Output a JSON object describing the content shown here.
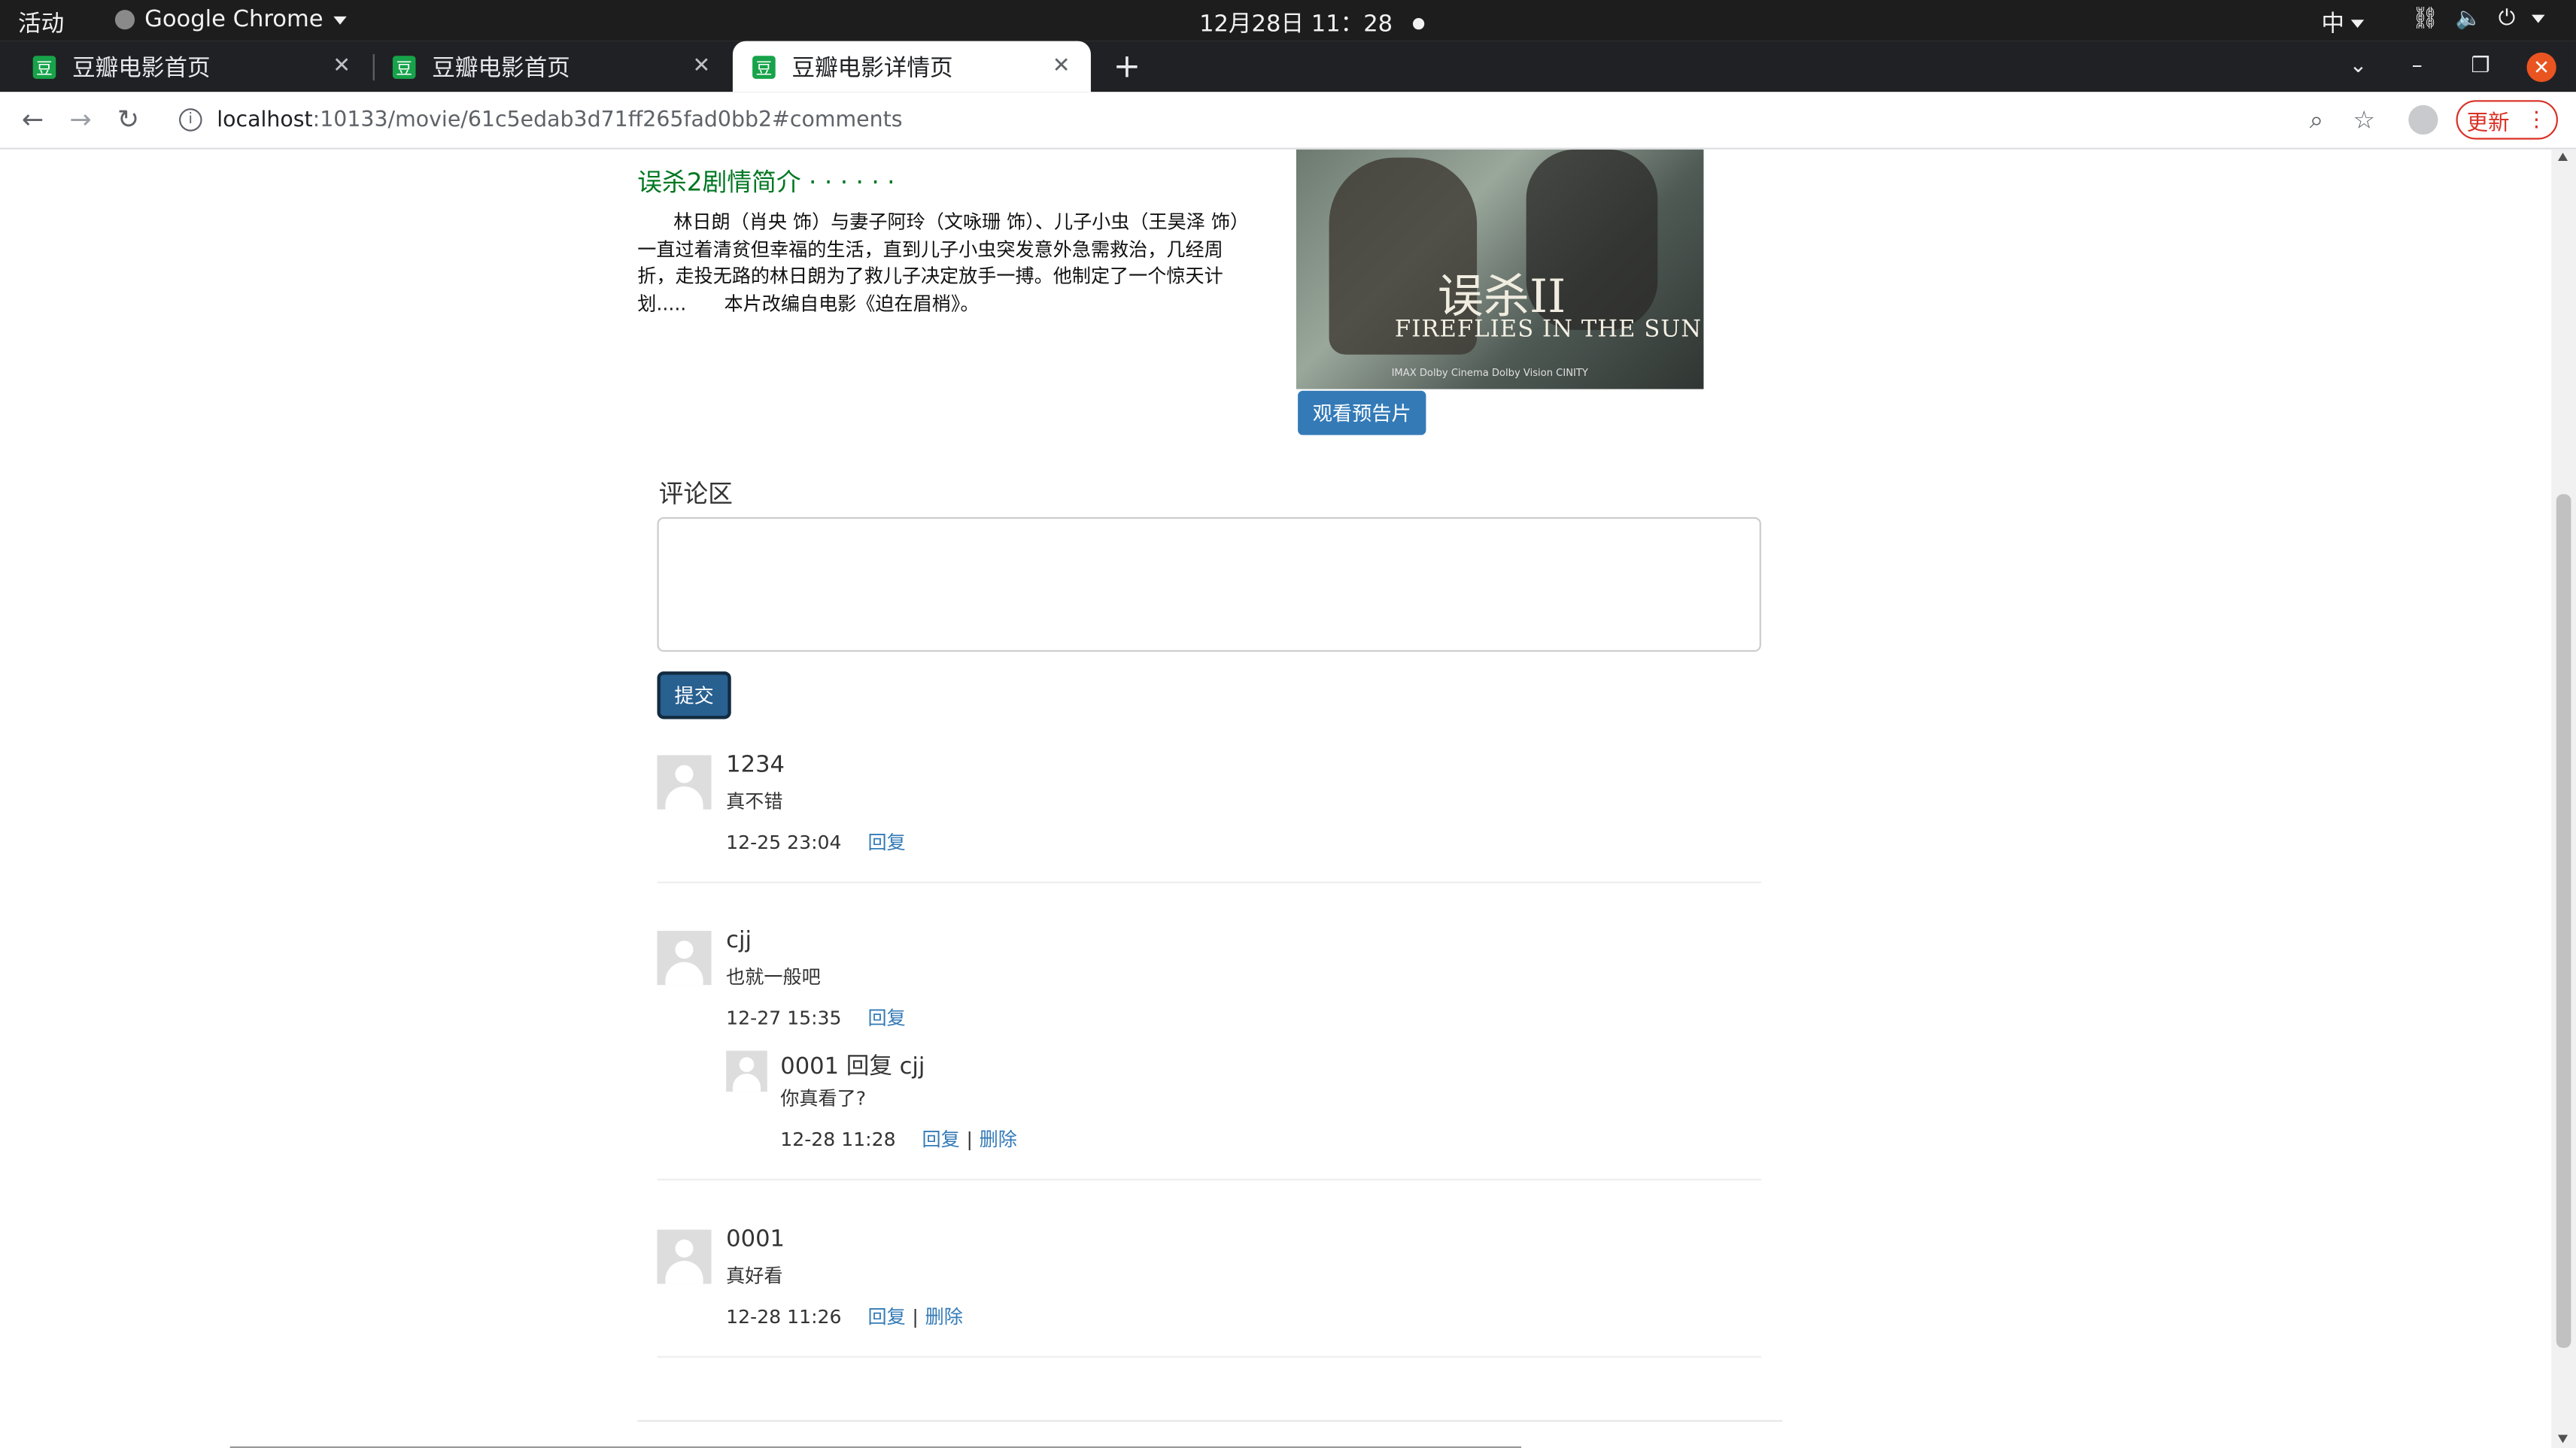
{
  "system_bar": {
    "activities": "活动",
    "app_name": "Google Chrome",
    "clock": "12月28日  11：28",
    "input_method": "中"
  },
  "browser": {
    "tabs": [
      {
        "favicon": "豆",
        "title": "豆瓣电影首页"
      },
      {
        "favicon": "豆",
        "title": "豆瓣电影首页"
      },
      {
        "favicon": "豆",
        "title": "豆瓣电影详情页"
      }
    ],
    "url_host": "localhost",
    "url_rest": ":10133/movie/61c5edab3d71ff265fad0bb2#comments",
    "update_label": "更新"
  },
  "movie": {
    "intro_title": "误杀2剧情简介 · · · · · ·",
    "intro_text": "林日朗（肖央 饰）与妻子阿玲（文咏珊 饰）、儿子小虫（王昊泽 饰）一直过着清贫但幸福的生活，直到儿子小虫突发意外急需救治，几经周折，走投无路的林日朗为了救儿子决定放手一搏。他制定了一个惊天计划.....　　本片改编自电影《迫在眉梢》。",
    "poster_cn": "误杀II",
    "poster_en": "FIREFLIES IN THE SUN",
    "poster_credits": "IMAX  Dolby Cinema  Dolby Vision  CINITY",
    "trailer_label": "观看预告片"
  },
  "comments_section": {
    "heading": "评论区",
    "submit_label": "提交",
    "items": [
      {
        "user": "1234",
        "text": "真不错",
        "time": "12-25 23:04",
        "reply": "回复"
      },
      {
        "user": "cjj",
        "text": "也就一般吧",
        "time": "12-27 15:35",
        "reply": "回复",
        "replies": [
          {
            "user": "0001 回复 cjj",
            "text": "你真看了?",
            "time": "12-28 11:28",
            "reply": "回复",
            "sep": "|",
            "delete": "删除"
          }
        ]
      },
      {
        "user": "0001",
        "text": "真好看",
        "time": "12-28 11:26",
        "reply": "回复",
        "sep": "|",
        "delete": "删除"
      }
    ]
  },
  "icons": {
    "back": "arrow-left-icon",
    "forward": "arrow-right-icon",
    "reload": "reload-icon",
    "info": "info-icon",
    "zoom": "zoom-icon",
    "bookmark": "star-icon",
    "profile": "profile-icon",
    "menu": "kebab-menu-icon",
    "new_tab": "plus-icon",
    "close_tab": "close-icon"
  },
  "colors": {
    "accent_link": "#337ab7",
    "intro_title": "#007722",
    "submit": "#286090",
    "update": "#d93025",
    "tab_favicon": "#17a34a"
  }
}
